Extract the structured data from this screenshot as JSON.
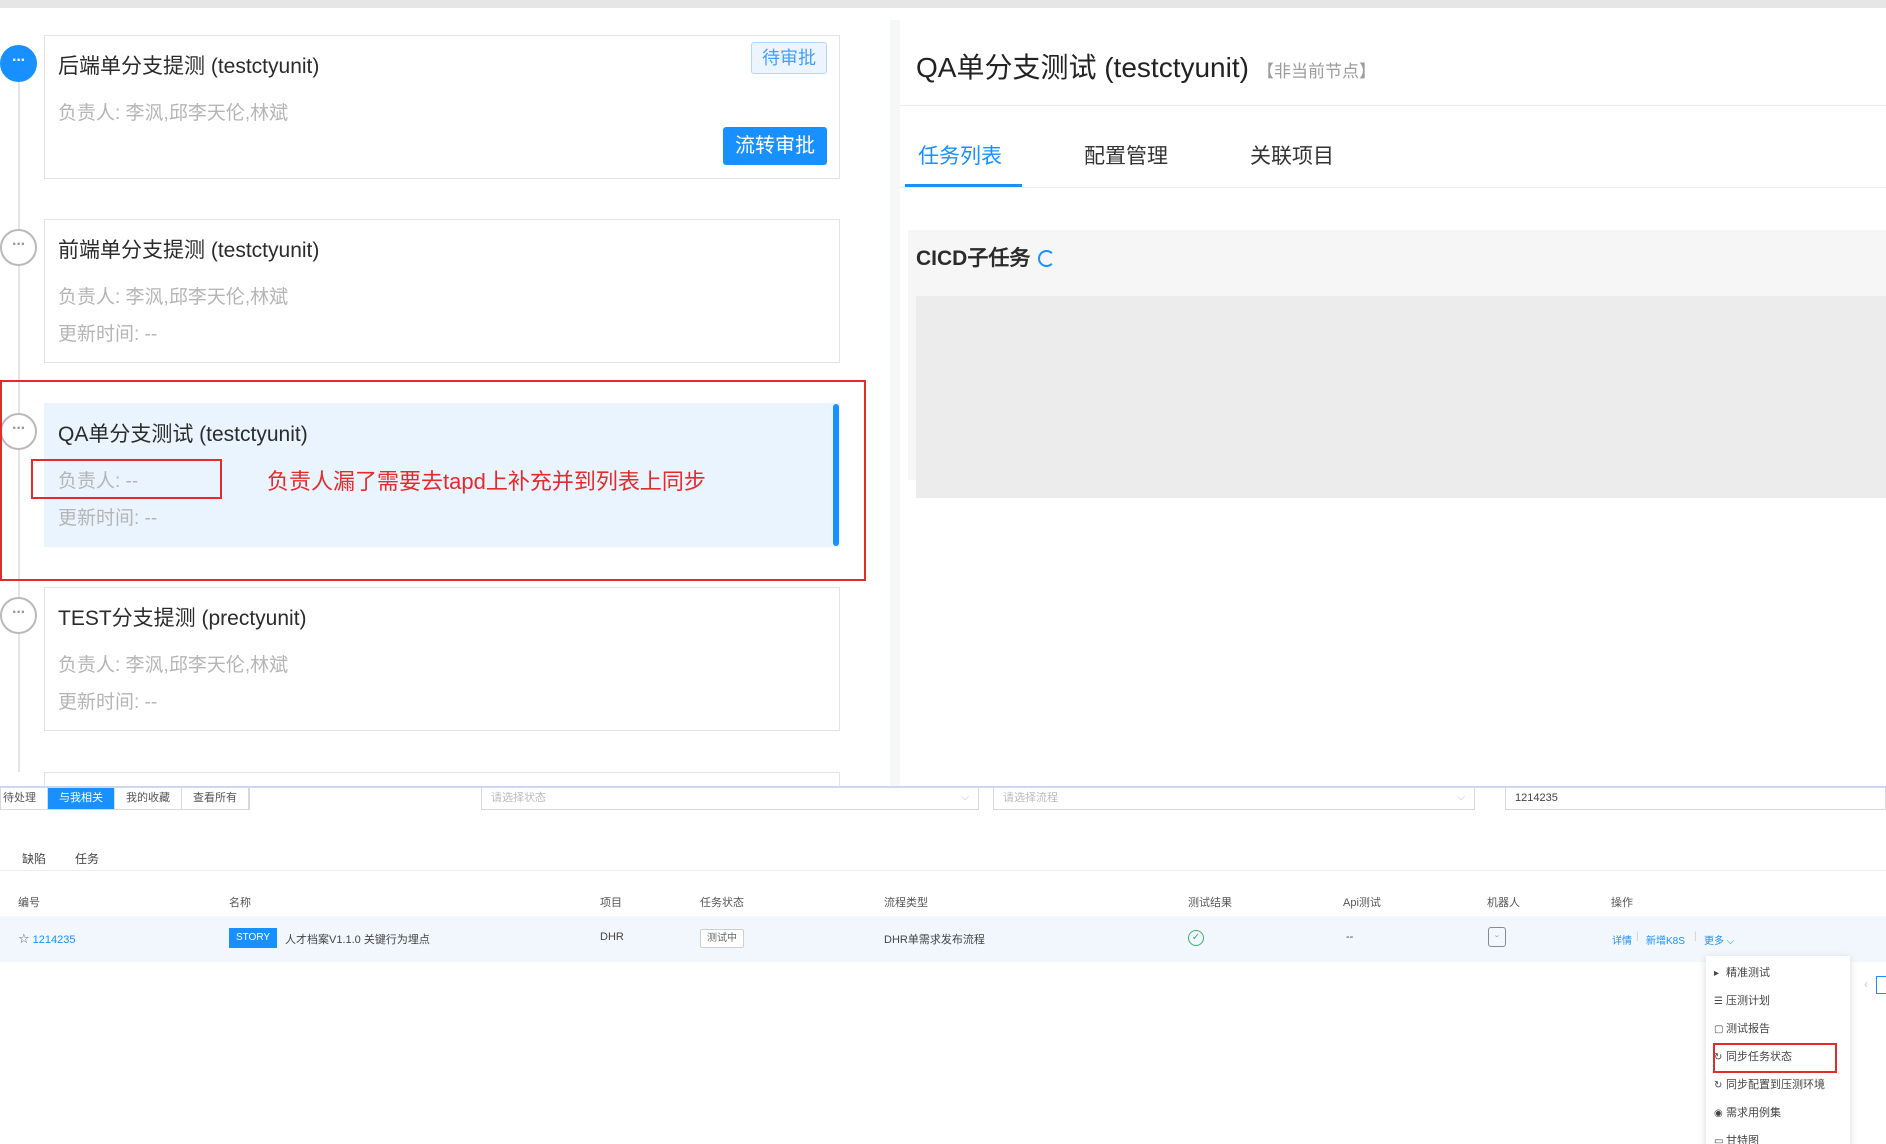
{
  "workflow": {
    "nodes": [
      {
        "title": "后端单分支提测 (testctyunit)",
        "owner": "负责人: 李沨,邱李天伦,林斌",
        "badge": "待审批",
        "action": "流转审批"
      },
      {
        "title": "前端单分支提测 (testctyunit)",
        "owner": "负责人: 李沨,邱李天伦,林斌",
        "updated": "更新时间: --"
      },
      {
        "title": "QA单分支测试 (testctyunit)",
        "owner": "负责人: --",
        "updated": "更新时间: --"
      },
      {
        "title": "TEST分支提测 (prectyunit)",
        "owner": "负责人: 李沨,邱李天伦,林斌",
        "updated": "更新时间: --"
      }
    ],
    "node_icon": "···"
  },
  "annotation": {
    "text": "负责人漏了需要去tapd上补充并到列表上同步",
    "color": "#e32b2b"
  },
  "detail": {
    "title": "QA单分支测试 (testctyunit)",
    "tag": "【非当前节点】",
    "tabs": [
      "任务列表",
      "配置管理",
      "关联项目"
    ],
    "cicd_title": "CICD子任务"
  },
  "task_list": {
    "segments": [
      "待处理",
      "与我相关",
      "我的收藏",
      "查看所有"
    ],
    "filters": {
      "status_placeholder": "请选择状态",
      "flow_placeholder": "请选择流程",
      "search_value": "1214235"
    },
    "subtabs": [
      "缺陷",
      "任务"
    ],
    "columns": [
      "编号",
      "名称",
      "项目",
      "任务状态",
      "流程类型",
      "测试结果",
      "Api测试",
      "机器人",
      "操作"
    ],
    "row": {
      "id": "1214235",
      "type_badge": "STORY",
      "name": "人才档案V1.1.0 关键行为埋点",
      "project": "DHR",
      "status": "测试中",
      "flow": "DHR单需求发布流程",
      "api": "--",
      "ops": [
        "详情",
        "新增K8S",
        "更多"
      ]
    },
    "more_menu": [
      "精准测试",
      "压测计划",
      "测试报告",
      "同步任务状态",
      "同步配置到压测环境",
      "需求用例集",
      "甘特图"
    ]
  },
  "colors": {
    "primary": "#1890ff",
    "active_card_bg": "#eaf4fe",
    "annotation_red": "#e32b2b",
    "success": "#36b36a"
  }
}
